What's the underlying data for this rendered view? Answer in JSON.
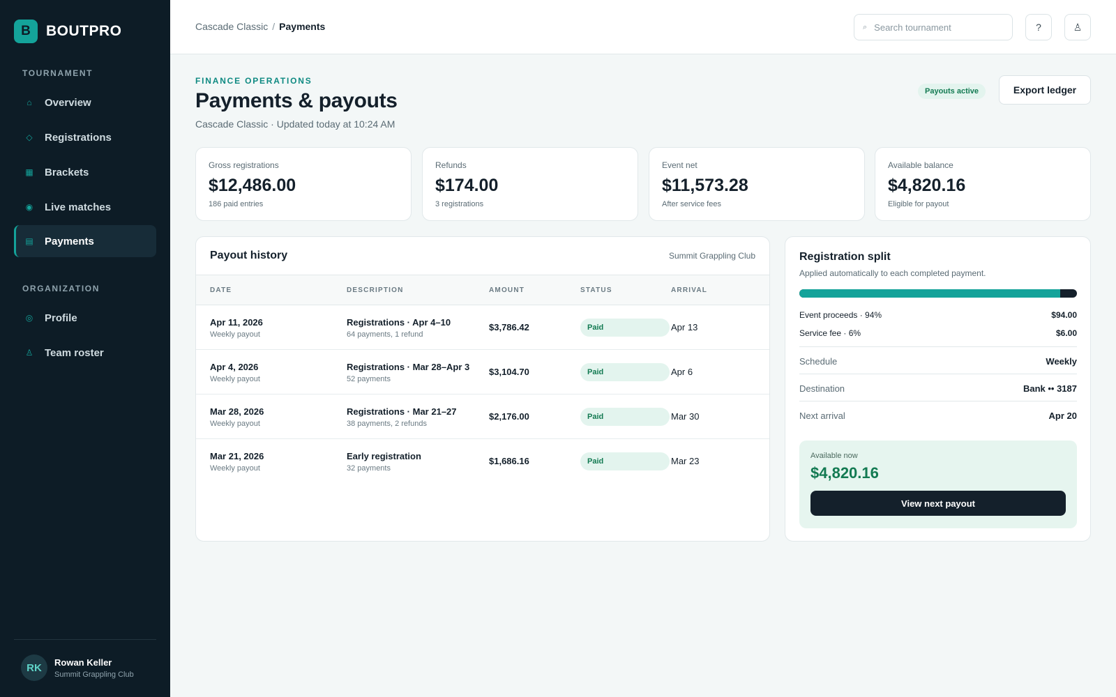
{
  "brand": {
    "logo_letter": "B",
    "name": "BOUTPRO"
  },
  "sidebar": {
    "section_tournament": "TOURNAMENT",
    "section_organization": "ORGANIZATION",
    "items": [
      {
        "label": "Overview",
        "icon": "home-icon",
        "glyph": "⌂"
      },
      {
        "label": "Registrations",
        "icon": "diamond-icon",
        "glyph": "◇"
      },
      {
        "label": "Brackets",
        "icon": "grid-icon",
        "glyph": "▦"
      },
      {
        "label": "Live matches",
        "icon": "live-dot-icon",
        "glyph": "◉"
      },
      {
        "label": "Payments",
        "icon": "ledger-icon",
        "glyph": "▤",
        "active": true
      },
      {
        "label": "Profile",
        "icon": "circle-icon",
        "glyph": "◎"
      },
      {
        "label": "Team roster",
        "icon": "person-icon",
        "glyph": "♙"
      }
    ],
    "user": {
      "initials": "RK",
      "name": "Rowan Keller",
      "org": "Summit Grappling Club"
    }
  },
  "topbar": {
    "breadcrumb_parent": "Cascade Classic",
    "breadcrumb_sep": "/",
    "breadcrumb_current": "Payments",
    "search_placeholder": "Search tournament",
    "search_icon": "⌕",
    "help_glyph": "?",
    "account_glyph": "♙"
  },
  "header": {
    "eyebrow": "FINANCE OPERATIONS",
    "title": "Payments & payouts",
    "subtitle": "Cascade Classic · Updated today at 10:24 AM",
    "status_badge": "Payouts active",
    "export_label": "Export ledger"
  },
  "stats": [
    {
      "label": "Gross registrations",
      "value": "$12,486.00",
      "sub": "186 paid entries"
    },
    {
      "label": "Refunds",
      "value": "$174.00",
      "sub": "3 registrations"
    },
    {
      "label": "Event net",
      "value": "$11,573.28",
      "sub": "After service fees"
    },
    {
      "label": "Available balance",
      "value": "$4,820.16",
      "sub": "Eligible for payout"
    }
  ],
  "history": {
    "title": "Payout history",
    "org": "Summit Grappling Club",
    "columns": [
      "DATE",
      "DESCRIPTION",
      "AMOUNT",
      "STATUS",
      "ARRIVAL"
    ],
    "rows": [
      {
        "date": "Apr 11, 2026",
        "date_sub": "Weekly payout",
        "desc": "Registrations · Apr 4–10",
        "desc_sub": "64 payments, 1 refund",
        "amount": "$3,786.42",
        "status": "Paid",
        "arrival": "Apr 13"
      },
      {
        "date": "Apr 4, 2026",
        "date_sub": "Weekly payout",
        "desc": "Registrations · Mar 28–Apr 3",
        "desc_sub": "52 payments",
        "amount": "$3,104.70",
        "status": "Paid",
        "arrival": "Apr 6"
      },
      {
        "date": "Mar 28, 2026",
        "date_sub": "Weekly payout",
        "desc": "Registrations · Mar 21–27",
        "desc_sub": "38 payments, 2 refunds",
        "amount": "$2,176.00",
        "status": "Paid",
        "arrival": "Mar 30"
      },
      {
        "date": "Mar 21, 2026",
        "date_sub": "Weekly payout",
        "desc": "Early registration",
        "desc_sub": "32 payments",
        "amount": "$1,686.16",
        "status": "Paid",
        "arrival": "Mar 23"
      }
    ]
  },
  "split": {
    "title": "Registration split",
    "subtitle": "Applied automatically to each completed payment.",
    "proceeds_fraction": 0.94,
    "proceeds_label": "Event proceeds · 94%",
    "proceeds_value": "$94.00",
    "fee_label": "Service fee · 6%",
    "fee_value": "$6.00",
    "details": [
      {
        "key": "Schedule",
        "value": "Weekly"
      },
      {
        "key": "Destination",
        "value": "Bank •• 3187"
      },
      {
        "key": "Next arrival",
        "value": "Apr 20"
      }
    ],
    "available_label": "Available now",
    "available_value": "$4,820.16",
    "button_label": "View next payout"
  },
  "colors": {
    "accent": "#14a39a",
    "sidebar": "#0d1c26",
    "success": "#137a52",
    "dark": "#14202b"
  }
}
